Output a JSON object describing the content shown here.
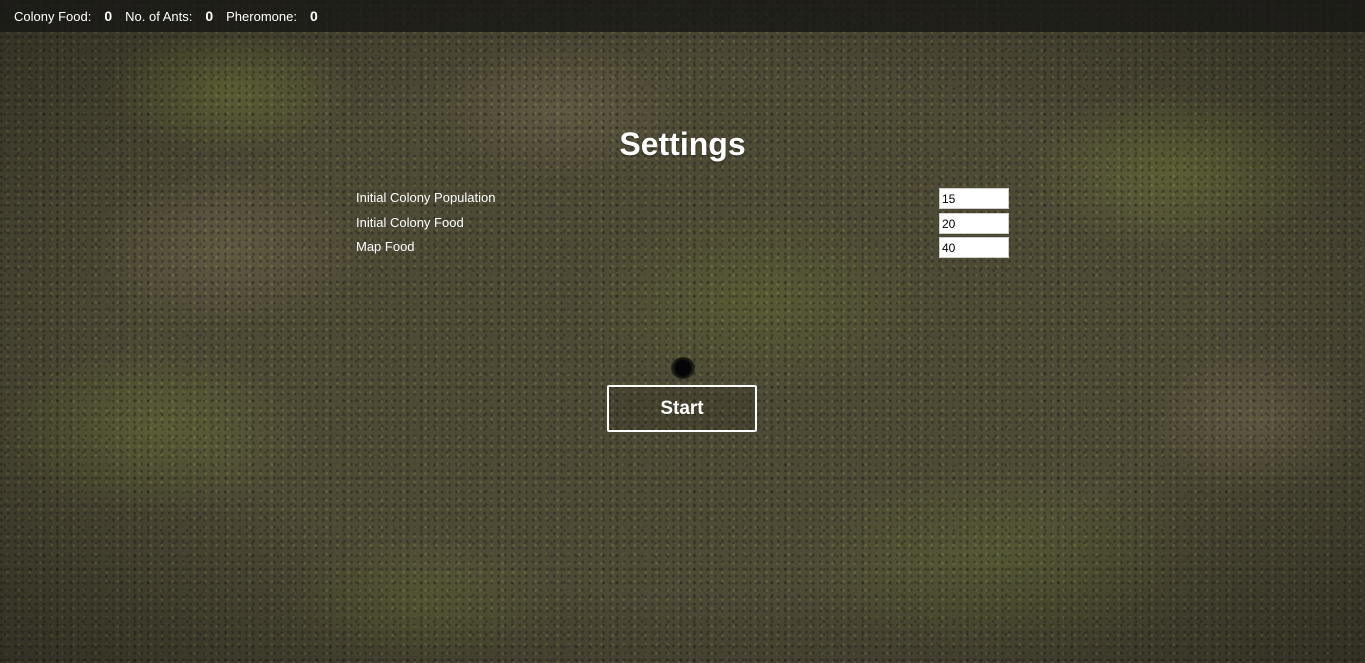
{
  "status_bar": {
    "colony_food_label": "Colony Food:",
    "colony_food_value": "0",
    "ants_label": "No. of Ants:",
    "ants_value": "0",
    "pheromone_label": "Pheromone:",
    "pheromone_value": "0"
  },
  "settings": {
    "title": "Settings",
    "fields": [
      {
        "label": "Initial Colony Population",
        "value": "15"
      },
      {
        "label": "Initial Colony Food",
        "value": "20"
      },
      {
        "label": "Map Food",
        "value": "40"
      }
    ]
  },
  "start_button": {
    "label": "Start"
  },
  "background": {
    "description_icon": "grass-ground-texture"
  }
}
